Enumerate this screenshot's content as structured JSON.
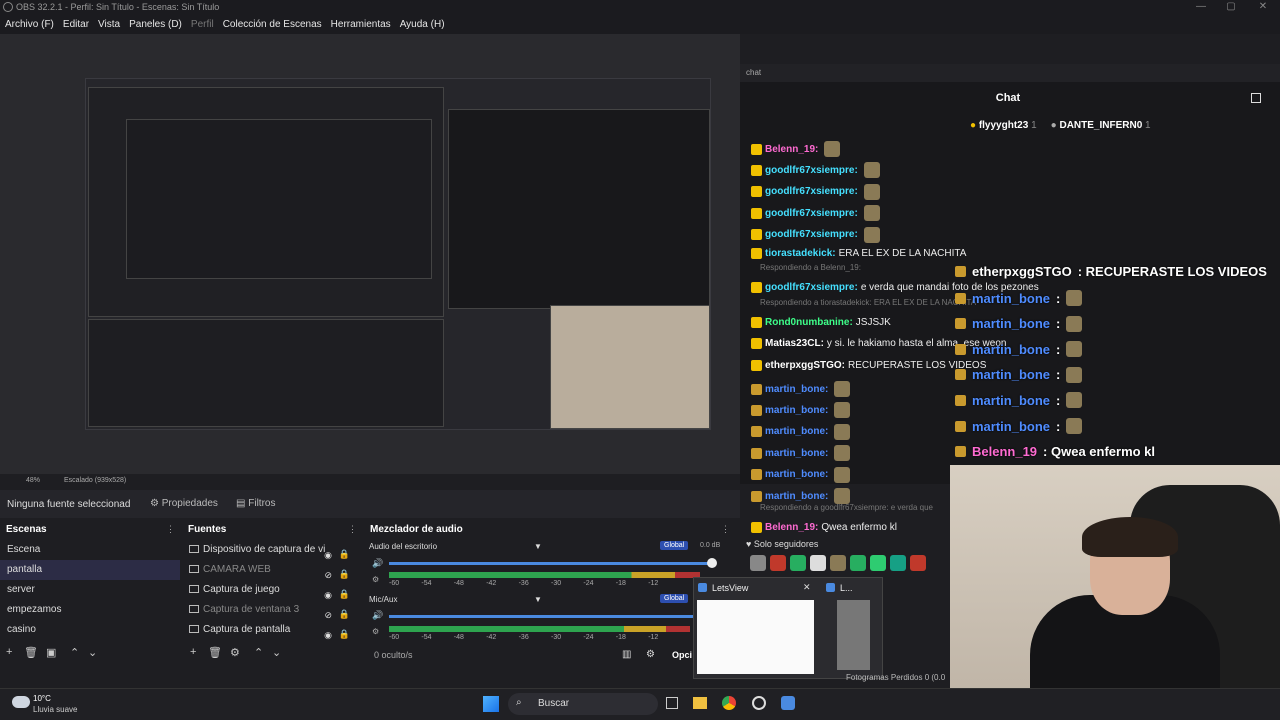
{
  "window": {
    "title": "OBS 32.2.1 - Perfil: Sin Título - Escenas: Sin Título"
  },
  "menu": [
    "Archivo (F)",
    "Editar",
    "Vista",
    "Paneles (D)",
    "Perfil",
    "Colección de Escenas",
    "Herramientas",
    "Ayuda (H)"
  ],
  "preview": {
    "zoom": "48%",
    "scale": "Escalado (939x528)"
  },
  "chat": {
    "header": "chat",
    "title": "Chat",
    "top_users": [
      {
        "name": "flyyyght23",
        "count": "1"
      },
      {
        "name": "DANTE_INFERN0",
        "count": "1"
      }
    ],
    "messages": [
      {
        "user": "Belenn_19:",
        "text": "",
        "color": "n-pink"
      },
      {
        "user": "goodlfr67xsiempre:",
        "text": "",
        "color": "n-cyan"
      },
      {
        "user": "goodlfr67xsiempre:",
        "text": "",
        "color": "n-cyan"
      },
      {
        "user": "goodlfr67xsiempre:",
        "text": "",
        "color": "n-cyan"
      },
      {
        "user": "goodlfr67xsiempre:",
        "text": "",
        "color": "n-cyan"
      },
      {
        "user": "tiorastadekick:",
        "text": "ERA EL EX DE LA NACHITA",
        "color": "n-cyan"
      },
      {
        "reply": "Respondiendo a Belenn_19:"
      },
      {
        "user": "goodlfr67xsiempre:",
        "text": "e verda que mandai foto de los pezones",
        "color": "n-cyan"
      },
      {
        "reply": "Respondiendo a tiorastadekick: ERA EL EX DE LA NACHITA"
      },
      {
        "user": "Rond0numbanine:",
        "text": "JSJSJK",
        "color": "n-green"
      },
      {
        "user": "Matias23CL:",
        "text": "y si. le hakiamo hasta el alma. ese weon",
        "color": "n-white"
      },
      {
        "user": "etherpxggSTGO:",
        "text": "RECUPERASTE LOS VIDEOS",
        "color": "n-white"
      },
      {
        "user": "martin_bone:",
        "text": "",
        "color": "n-blue"
      },
      {
        "user": "martin_bone:",
        "text": "",
        "color": "n-blue"
      },
      {
        "user": "martin_bone:",
        "text": "",
        "color": "n-blue"
      },
      {
        "user": "martin_bone:",
        "text": "",
        "color": "n-blue"
      },
      {
        "user": "martin_bone:",
        "text": "",
        "color": "n-blue"
      },
      {
        "user": "martin_bone:",
        "text": "",
        "color": "n-blue"
      },
      {
        "reply": "Respondiendo a goodlfr67xsiempre: e verda que"
      },
      {
        "user": "Belenn_19:",
        "text": "Qwea enfermo kl",
        "color": "n-pink"
      }
    ],
    "followers_only": "Solo seguidores"
  },
  "overlay_chat": [
    {
      "user": "etherpxggSTGO",
      "text": ": RECUPERASTE LOS VIDEOS"
    },
    {
      "user": "martin_bone",
      "text": ":"
    },
    {
      "user": "martin_bone",
      "text": ":"
    },
    {
      "user": "martin_bone",
      "text": ":"
    },
    {
      "user": "martin_bone",
      "text": ":"
    },
    {
      "user": "martin_bone",
      "text": ":"
    },
    {
      "user": "martin_bone",
      "text": ":"
    },
    {
      "user": "Belenn_19",
      "text": ": Qwea enfermo kl"
    }
  ],
  "props_bar": {
    "source": "Ninguna fuente seleccionad",
    "properties": "Propiedades",
    "filters": "Filtros"
  },
  "scenes": {
    "title": "Escenas",
    "items": [
      "Escena",
      "pantalla",
      "server",
      "empezamos",
      "casino"
    ],
    "selected": 1
  },
  "sources": {
    "title": "Fuentes",
    "items": [
      {
        "label": "Dispositivo de captura de vi",
        "visible": true
      },
      {
        "label": "CAMARA WEB",
        "visible": false
      },
      {
        "label": "Captura de juego",
        "visible": true
      },
      {
        "label": "Captura de ventana 3",
        "visible": false
      },
      {
        "label": "Captura de pantalla",
        "visible": true
      }
    ]
  },
  "mixer": {
    "title": "Mezclador de audio",
    "channels": [
      {
        "name": "Audio del escritorio",
        "global": "Global",
        "db": "0.0 dB",
        "level": 0.96
      },
      {
        "name": "Mic/Aux",
        "global": "Global",
        "db": "",
        "level": 0.93
      }
    ],
    "ticks": [
      "-60",
      "-54",
      "-48",
      "-42",
      "-36",
      "-30",
      "-24",
      "-18",
      "-12"
    ],
    "hidden": "0 oculto/s",
    "options": "Opci"
  },
  "popup": {
    "app": "LetsView",
    "app2": "L..."
  },
  "status": {
    "frames": "Fotogramas Perdidos 0 (0.0"
  },
  "taskbar": {
    "weather_temp": "10°C",
    "weather_desc": "Lluvia suave",
    "search": "Buscar"
  }
}
